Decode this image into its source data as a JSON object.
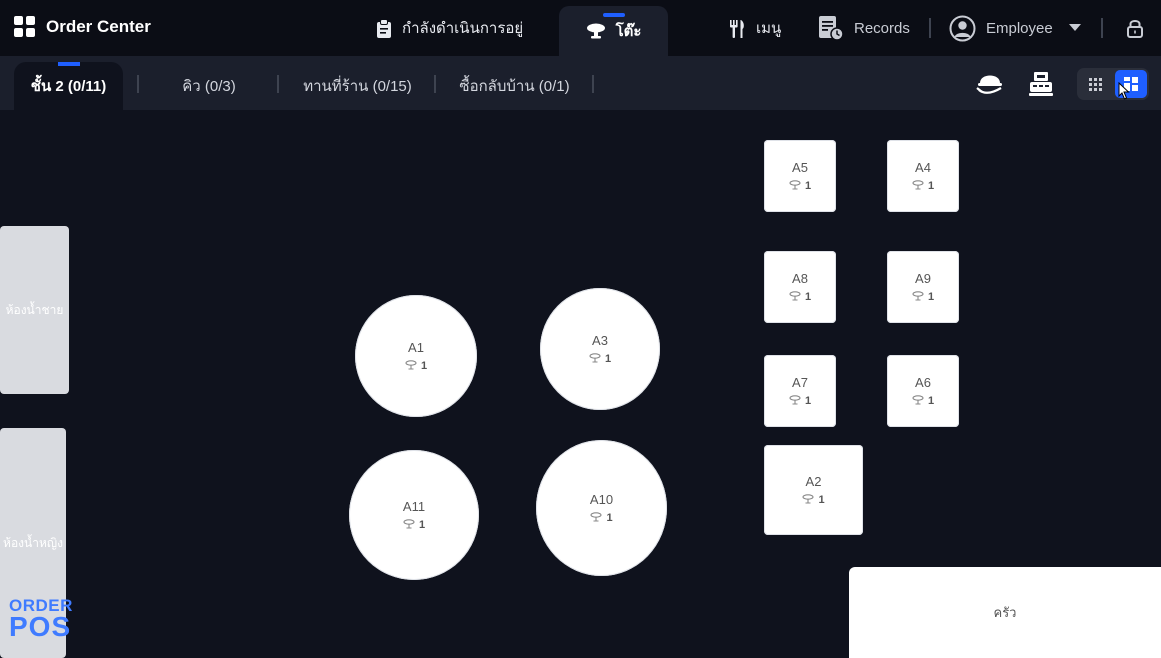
{
  "app": {
    "title": "Order Center"
  },
  "nav": {
    "items": [
      {
        "label": "กำลังดำเนินการอยู่",
        "icon": "clipboard-icon"
      },
      {
        "label": "โต๊ะ",
        "icon": "table-icon",
        "active": true
      },
      {
        "label": "เมนู",
        "icon": "cutlery-icon"
      },
      {
        "label": "Records",
        "icon": "records-icon"
      }
    ],
    "user": {
      "label": "Employee",
      "icon": "user-avatar-icon"
    },
    "lock_icon": "lock-icon"
  },
  "floor_tabs": [
    {
      "label": "ชั้น 2 (0/11)",
      "active": true
    },
    {
      "label": "คิว (0/3)"
    },
    {
      "label": "ทานที่ร้าน (0/15)"
    },
    {
      "label": "ซื้อกลับบ้าน (0/1)"
    }
  ],
  "toolbar": {
    "icons": [
      "waiter-service-icon",
      "cashier-icon"
    ],
    "view_modes": [
      "grid-view-icon",
      "floorplan-view-icon"
    ],
    "active_view": "floorplan-view-icon"
  },
  "tables": [
    {
      "name": "A5",
      "seats": "1"
    },
    {
      "name": "A4",
      "seats": "1"
    },
    {
      "name": "A8",
      "seats": "1"
    },
    {
      "name": "A9",
      "seats": "1"
    },
    {
      "name": "A7",
      "seats": "1"
    },
    {
      "name": "A6",
      "seats": "1"
    },
    {
      "name": "A2",
      "seats": "1"
    },
    {
      "name": "A1",
      "seats": "1"
    },
    {
      "name": "A3",
      "seats": "1"
    },
    {
      "name": "A11",
      "seats": "1"
    },
    {
      "name": "A10",
      "seats": "1"
    }
  ],
  "rooms": {
    "mens_restroom": "ห้องน้ำชาย",
    "womens_restroom": "ห้องน้ำหญิง",
    "kitchen": "ครัว"
  },
  "logo": {
    "line1": "ORDER",
    "line2": "POS"
  },
  "colors": {
    "accent": "#1f5fff",
    "background": "#0f121d",
    "topbar": "#0b0d15",
    "subbar": "#1b1f2c"
  }
}
